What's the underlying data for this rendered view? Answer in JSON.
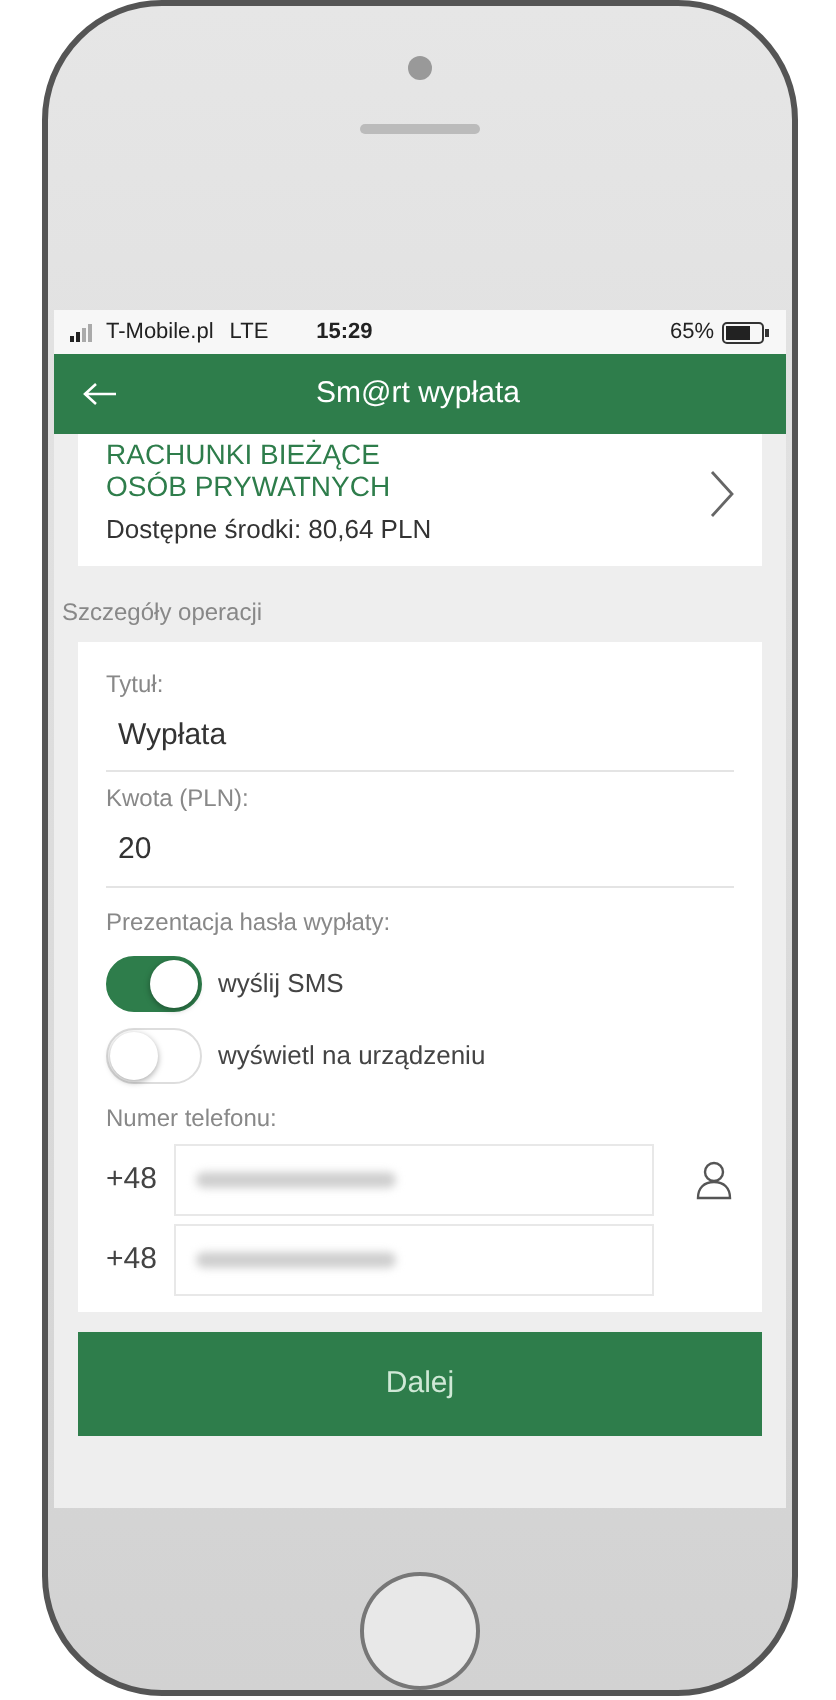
{
  "status_bar": {
    "carrier": "T-Mobile.pl",
    "network": "LTE",
    "time": "15:29",
    "battery": "65%"
  },
  "header": {
    "title": "Sm@rt wypłata"
  },
  "account": {
    "name_lines": [
      "RACHUNKI BIEŻĄCE",
      "OSÓB PRYWATNYCH"
    ],
    "balance": "Dostępne środki: 80,64 PLN"
  },
  "section_label": "Szczegóły operacji",
  "fields": [
    {
      "label": "Tytuł:",
      "value": "Wypłata"
    },
    {
      "label": "Kwota (PLN):",
      "value": "20"
    }
  ],
  "presentation": {
    "label": "Prezentacja  hasła wypłaty:",
    "options": [
      {
        "label": "wyślij SMS",
        "on": true
      },
      {
        "label": "wyświetl na urządzeniu",
        "on": false
      }
    ]
  },
  "phone": {
    "label": "Numer telefonu:",
    "rows": [
      {
        "prefix": "+48",
        "contact_picker": true
      },
      {
        "prefix": "+48",
        "contact_picker": false
      }
    ]
  },
  "button": "Dalej"
}
